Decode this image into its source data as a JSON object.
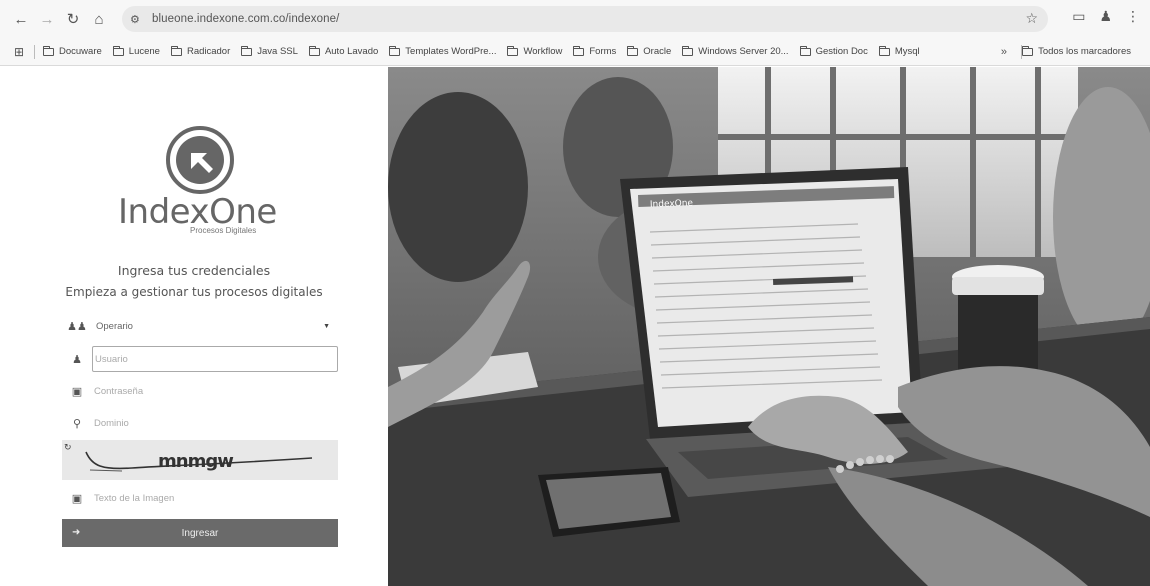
{
  "browser": {
    "url": "blueone.indexone.com.co/indexone/",
    "bookmarks": [
      "Docuware",
      "Lucene",
      "Radicador",
      "Java SSL",
      "Auto Lavado",
      "Templates WordPre...",
      "Workflow",
      "Forms",
      "Oracle",
      "Windows Server 20...",
      "Gestion Doc",
      "Mysql"
    ],
    "all_bookmarks_label": "Todos los marcadores"
  },
  "login": {
    "logo_text": "IndexOne",
    "logo_subtitle": "Procesos Digitales",
    "title": "Ingresa tus credenciales",
    "subtitle": "Empieza a gestionar tus procesos digitales",
    "role_value": "Operario",
    "user_placeholder": "Usuario",
    "password_placeholder": "Contraseña",
    "domain_placeholder": "Dominio",
    "captcha_text": "mnmgw",
    "captcha_input_placeholder": "Texto de la Imagen",
    "submit_label": "Ingresar"
  },
  "hero": {
    "screen_brand": "IndexOne"
  }
}
